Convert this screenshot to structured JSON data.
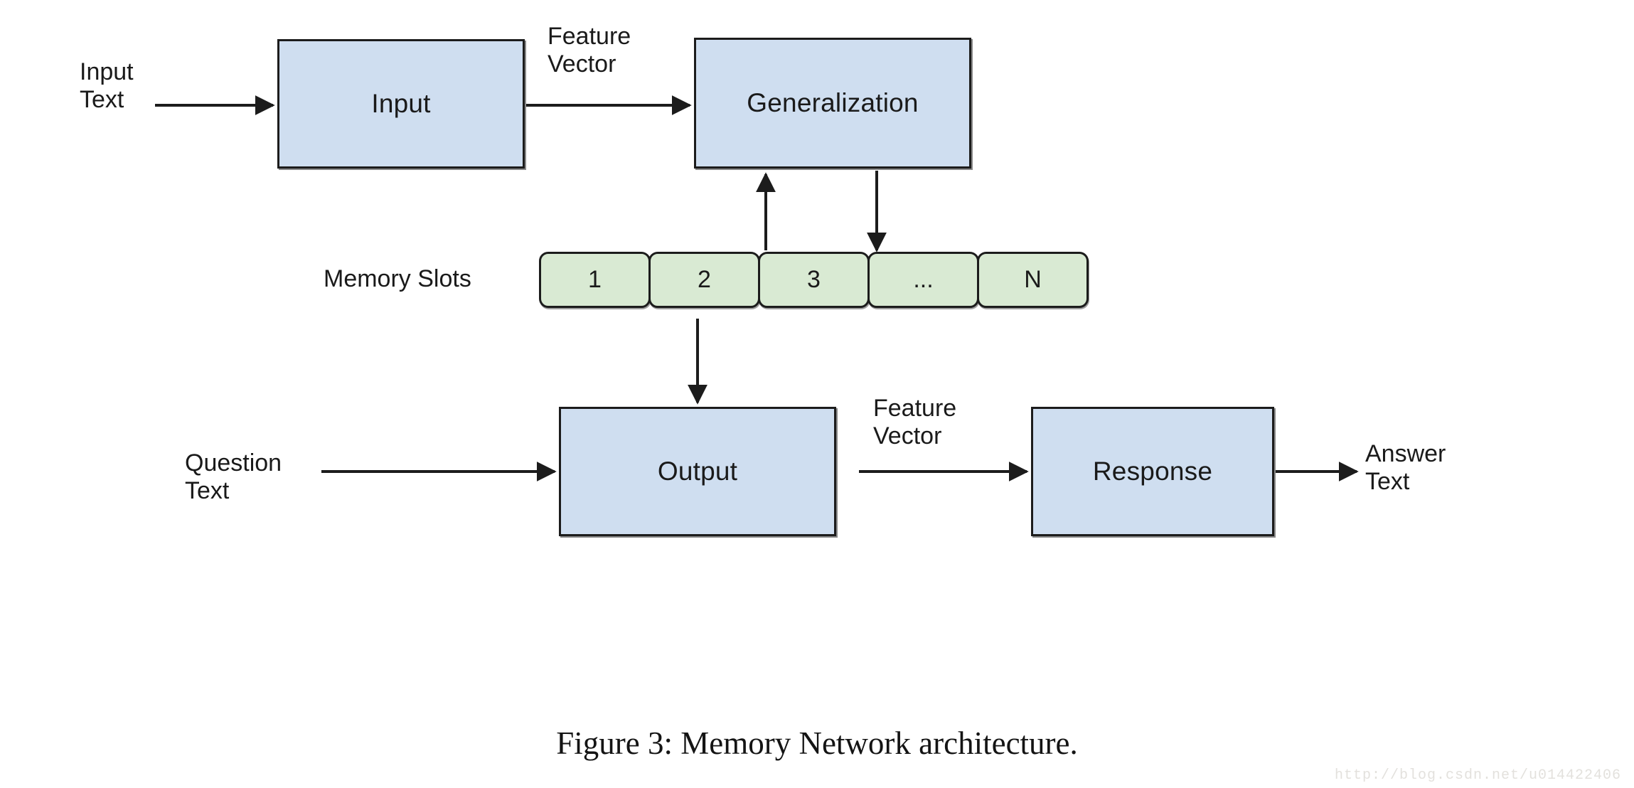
{
  "figure": {
    "caption": "Figure 3:  Memory Network architecture.",
    "watermark": "http://blog.csdn.net/u014422406"
  },
  "colors": {
    "process_fill": "#cfdef0",
    "memory_fill": "#d9ead3",
    "stroke": "#1c1c1c",
    "text": "#1a1a1a",
    "background": "#ffffff",
    "watermark_text": "#e3e1dd"
  },
  "boxes": {
    "input": "Input",
    "generalization": "Generalization",
    "output": "Output",
    "response": "Response"
  },
  "labels": {
    "input_text": "Input\nText",
    "feature_vector_top": "Feature\nVector",
    "memory_slots": "Memory Slots",
    "question_text": "Question\nText",
    "feature_vector_bottom": "Feature\nVector",
    "answer_text": "Answer\nText"
  },
  "memory_slots": [
    {
      "label": "1"
    },
    {
      "label": "2"
    },
    {
      "label": "3"
    },
    {
      "label": "..."
    },
    {
      "label": "N"
    }
  ],
  "connections": [
    {
      "from": "input_text",
      "to": "input",
      "label": "",
      "direction": "right"
    },
    {
      "from": "input",
      "to": "generalization",
      "label": "Feature Vector",
      "direction": "right"
    },
    {
      "from": "generalization",
      "to": "memory_slots",
      "label": "",
      "direction": "down"
    },
    {
      "from": "memory_slots",
      "to": "generalization",
      "label": "",
      "direction": "up"
    },
    {
      "from": "memory_slots",
      "to": "output",
      "label": "",
      "direction": "down"
    },
    {
      "from": "question_text",
      "to": "output",
      "label": "",
      "direction": "right"
    },
    {
      "from": "output",
      "to": "response",
      "label": "Feature Vector",
      "direction": "right"
    },
    {
      "from": "response",
      "to": "answer_text",
      "label": "",
      "direction": "right"
    }
  ]
}
